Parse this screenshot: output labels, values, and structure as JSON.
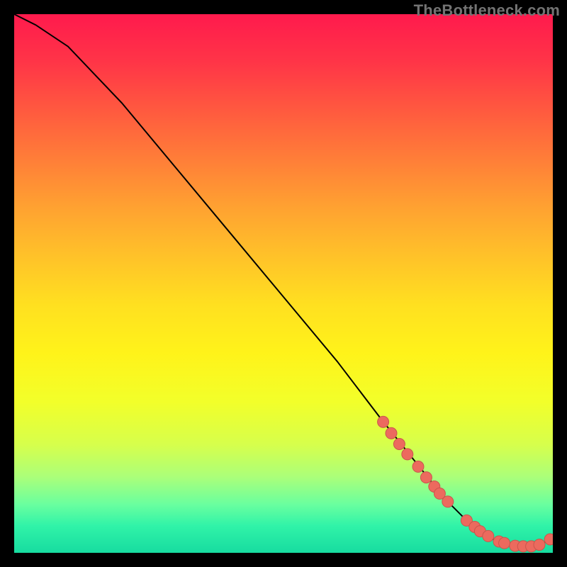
{
  "watermark": "TheBottleneck.com",
  "branding": {
    "text_color": "#737373"
  },
  "chart_data": {
    "type": "line",
    "title": "",
    "xlabel": "",
    "ylabel": "",
    "xlim": [
      0,
      100
    ],
    "ylim": [
      0,
      100
    ],
    "grid": false,
    "legend": false,
    "series": [
      {
        "name": "curve",
        "x": [
          0,
          4,
          10,
          20,
          30,
          40,
          50,
          60,
          68,
          72,
          76,
          80,
          84,
          87,
          90,
          93,
          96,
          98,
          100
        ],
        "y": [
          100,
          98,
          94,
          83.5,
          71.5,
          59.5,
          47.5,
          35.5,
          25,
          20,
          15,
          10,
          6,
          3.5,
          2,
          1.3,
          1.2,
          1.7,
          2.7
        ],
        "stroke": "#000000",
        "stroke_width": 2
      }
    ],
    "markers": {
      "name": "highlight-dots",
      "shape": "circle",
      "fill": "#ec6a5e",
      "stroke": "#c9564c",
      "radius": 8,
      "points_x": [
        68.5,
        70,
        71.5,
        73,
        75,
        76.5,
        78,
        79,
        80.5,
        84,
        85.5,
        86.5,
        88,
        90,
        91,
        93,
        94.5,
        96,
        97.5,
        99.5
      ],
      "points_y": [
        24.3,
        22.2,
        20.2,
        18.3,
        16,
        14,
        12.3,
        11,
        9.5,
        6,
        4.8,
        4,
        3.1,
        2.1,
        1.8,
        1.3,
        1.2,
        1.2,
        1.5,
        2.5
      ]
    }
  }
}
